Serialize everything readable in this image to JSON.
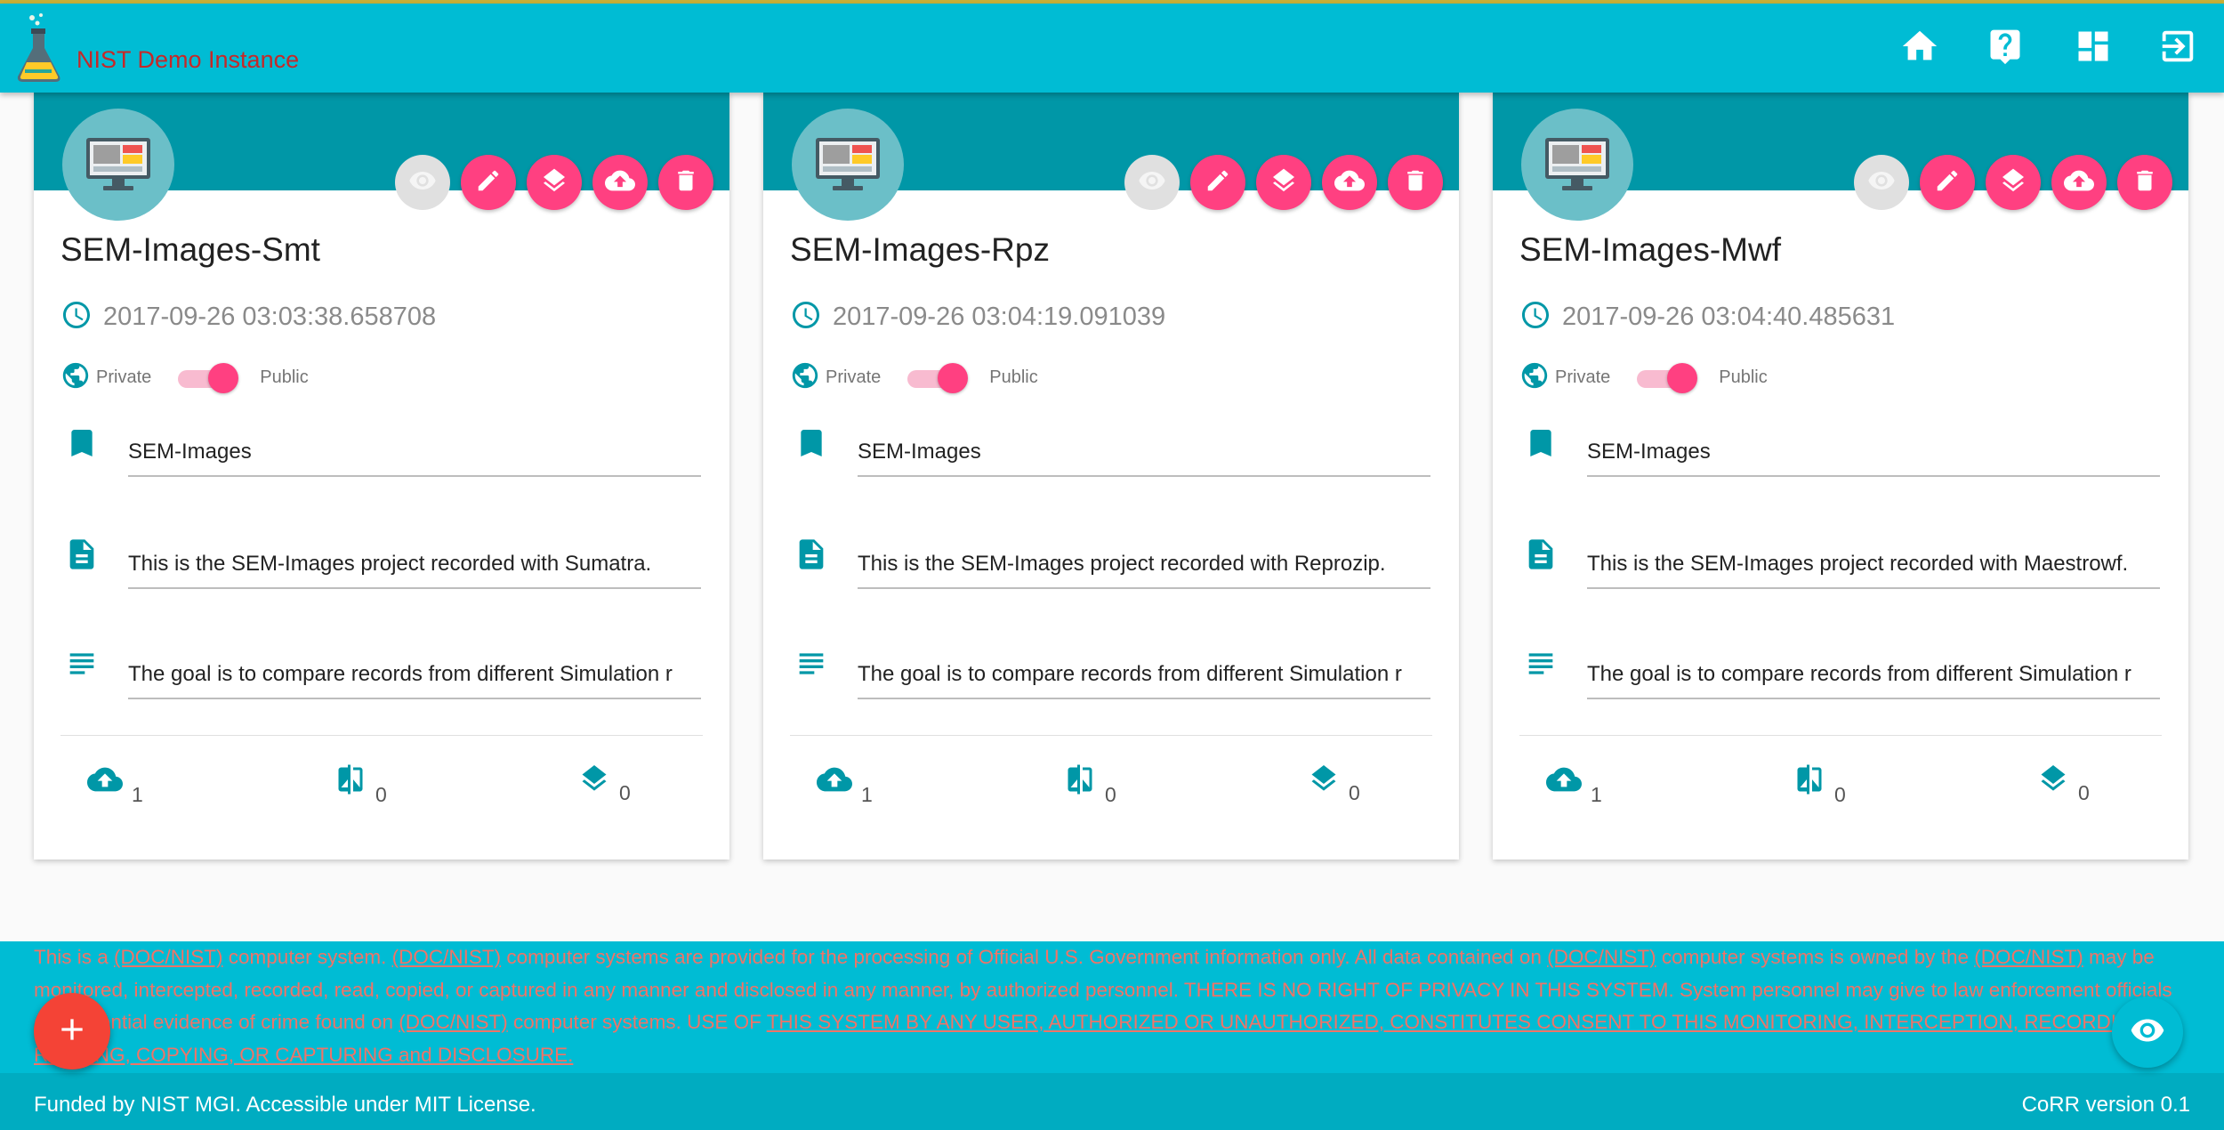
{
  "app": {
    "title": "NIST Demo Instance"
  },
  "nav": {
    "icons": [
      "home-icon",
      "help-icon",
      "dashboard-icon",
      "logout-icon"
    ]
  },
  "colors": {
    "primary": "#00bcd4",
    "card_band": "#0097a7",
    "accent": "#ff4081",
    "fab_add": "#f44336",
    "warning_text": "#ef7468"
  },
  "cards": [
    {
      "title": "SEM-Images-Smt",
      "timestamp": "2017-09-26 03:03:38.658708",
      "private_label": "Private",
      "public_label": "Public",
      "visibility": "public",
      "tags": "SEM-Images",
      "description": "This is the SEM-Images project recorded with Sumatra.",
      "goals": "The goal is to compare records from different Simulation r",
      "stats": {
        "records": "1",
        "diffs": "0",
        "environments": "0"
      }
    },
    {
      "title": "SEM-Images-Rpz",
      "timestamp": "2017-09-26 03:04:19.091039",
      "private_label": "Private",
      "public_label": "Public",
      "visibility": "public",
      "tags": "SEM-Images",
      "description": "This is the SEM-Images project recorded with Reprozip.",
      "goals": "The goal is to compare records from different Simulation r",
      "stats": {
        "records": "1",
        "diffs": "0",
        "environments": "0"
      }
    },
    {
      "title": "SEM-Images-Mwf",
      "timestamp": "2017-09-26 03:04:40.485631",
      "private_label": "Private",
      "public_label": "Public",
      "visibility": "public",
      "tags": "SEM-Images",
      "description": "This is the SEM-Images project recorded with Maestrowf.",
      "goals": "The goal is to compare records from different Simulation r",
      "stats": {
        "records": "1",
        "diffs": "0",
        "environments": "0"
      }
    }
  ],
  "warning": {
    "p1": "This is a ",
    "l1": "(DOC/NIST)",
    "p2": " computer system. ",
    "l2": "(DOC/NIST)",
    "p3": " computer systems are provided for the processing of Official U.S. Government information only. All data contained on ",
    "l3": "(DOC/NIST)",
    "p4": " computer systems is owned by the ",
    "l4": "(DOC/NIST)",
    "p5": " may be monitored, intercepted, recorded, read, copied, or captured in any manner and disclosed in any manner, by authorized personnel. THERE IS NO RIGHT OF PRIVACY IN THIS SYSTEM. System personnel may give to law enforcement officials any potential evidence of crime found on ",
    "l5": "(DOC/NIST)",
    "p6": " computer systems. USE OF ",
    "l6": "THIS SYSTEM BY ANY USER, AUTHORIZED OR UNAUTHORIZED, CONSTITUTES CONSENT TO THIS MONITORING, INTERCEPTION, RECORDING, READING, COPYING, OR CAPTURING and DISCLOSURE."
  },
  "footer": {
    "left": "Funded by NIST MGI. Accessible under MIT License.",
    "right": "CoRR version 0.1"
  }
}
